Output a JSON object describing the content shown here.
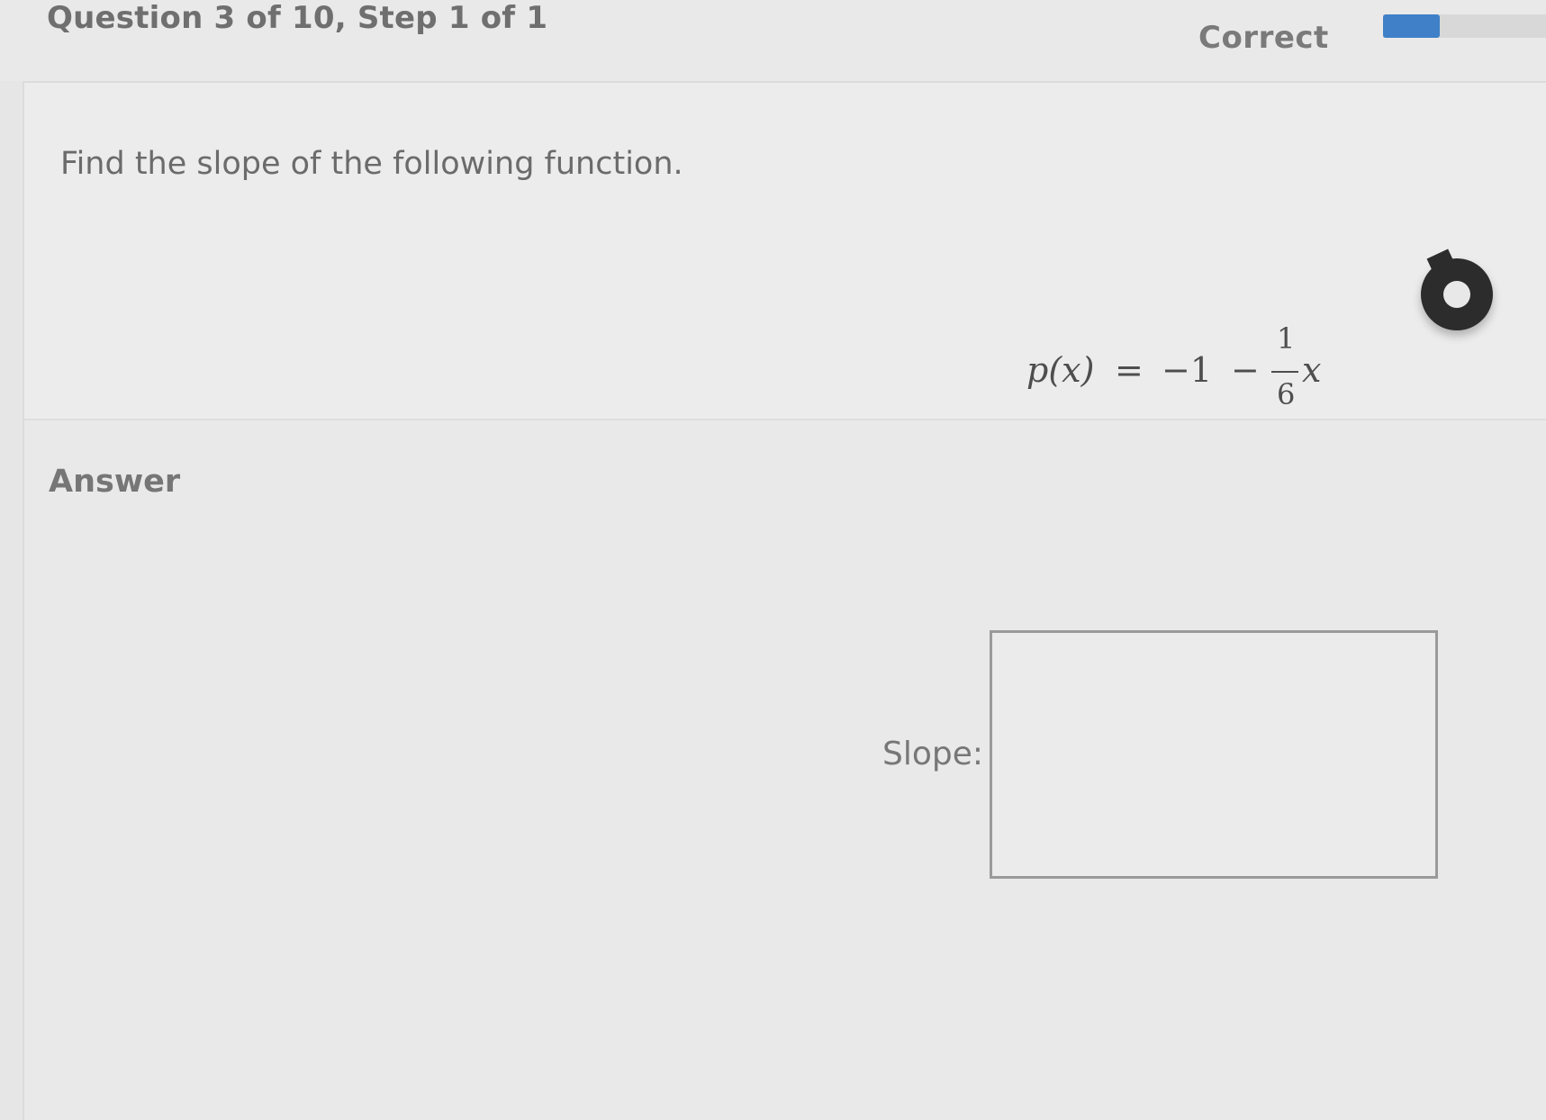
{
  "header": {
    "title": "Question 3 of 10, Step 1 of 1",
    "status": "Correct",
    "progress_fraction": 0.35
  },
  "question": {
    "prompt": "Find the slope of the following function.",
    "equation": {
      "lhs": "p(x)",
      "equals": "=",
      "term1": "−1",
      "operator": "−",
      "numerator": "1",
      "denominator": "6",
      "variable": "x"
    },
    "help_icon": "help-lifesaver-icon"
  },
  "answer": {
    "heading": "Answer",
    "slope_label": "Slope:",
    "slope_value": ""
  },
  "colors": {
    "progress": "#3f80c8",
    "help_button": "#2c2c2c"
  }
}
